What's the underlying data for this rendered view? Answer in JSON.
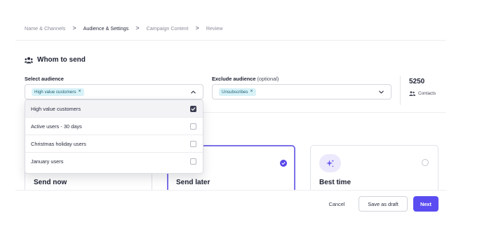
{
  "breadcrumb": {
    "items": [
      {
        "label": "Name & Channels"
      },
      {
        "label": "Audience & Settings"
      },
      {
        "label": "Campaign Content"
      },
      {
        "label": "Review"
      }
    ],
    "separator": ">",
    "active_index": 1
  },
  "section": {
    "title": "Whom to send",
    "icon": "users-group-icon"
  },
  "select_audience": {
    "label": "Select audience",
    "chip": "High value customers",
    "chip_remove": "×",
    "expanded": true,
    "options": [
      {
        "label": "High value customers",
        "checked": true
      },
      {
        "label": "Active users - 30 days",
        "checked": false
      },
      {
        "label": "Christmas holiday users",
        "checked": false
      },
      {
        "label": "January users",
        "checked": false
      }
    ]
  },
  "exclude_audience": {
    "label": "Exclude audience",
    "label_suffix": "(optional)",
    "chip": "Unsubscribes",
    "chip_remove": "×"
  },
  "contacts": {
    "count": "5250",
    "label": "Contacts",
    "icon": "contacts-icon"
  },
  "schedule": {
    "options": [
      {
        "title": "Send now",
        "selected": false
      },
      {
        "title": "Send later",
        "selected": true
      },
      {
        "title": "Best time",
        "selected": false,
        "icon": "sparkle-icon"
      }
    ]
  },
  "footer": {
    "cancel": "Cancel",
    "save_draft": "Save as draft",
    "next": "Next"
  },
  "colors": {
    "accent": "#5a4cf0",
    "chip_bg": "#d8f2f8",
    "chip_text": "#1c5f74",
    "active_card_border": "#7b71e8"
  }
}
